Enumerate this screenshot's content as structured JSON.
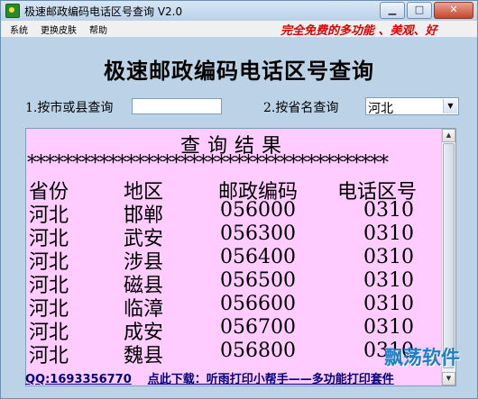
{
  "window": {
    "title": "极速邮政编码电话区号查询 V2.0"
  },
  "menu": [
    "系统",
    "更换皮肤",
    "帮助"
  ],
  "marquee": "完全免费的多功能 、美观、好",
  "app_title": "极速邮政编码电话区号查询",
  "city_query": {
    "label": "1.按市或县查询",
    "value": ""
  },
  "province_query": {
    "label": "2.按省名查询",
    "selected": "河北"
  },
  "results": {
    "title": "查询结果",
    "separator": "****************************************",
    "headers": [
      "省份",
      "地区",
      "邮政编码",
      "电话区号"
    ],
    "rows": [
      [
        "河北",
        "邯郸",
        "056000",
        "0310"
      ],
      [
        "河北",
        "武安",
        "056300",
        "0310"
      ],
      [
        "河北",
        "涉县",
        "056400",
        "0310"
      ],
      [
        "河北",
        "磁县",
        "056500",
        "0310"
      ],
      [
        "河北",
        "临漳",
        "056600",
        "0310"
      ],
      [
        "河北",
        "成安",
        "056700",
        "0310"
      ],
      [
        "河北",
        "魏县",
        "056800",
        "0310"
      ]
    ]
  },
  "footer": {
    "qq": "QQ:1693356770",
    "download": "点此下载：听雨打印小帮手——多功能打印套件"
  },
  "watermark": "飘荡软件",
  "colors": {
    "result_bg": "#ffccff",
    "window_bg": "#bcd3e7",
    "marquee": "#e00000",
    "link": "#000080"
  },
  "icons": [
    "app-icon",
    "minimize-icon",
    "maximize-icon",
    "close-icon",
    "dropdown-arrow-icon",
    "scroll-up-icon",
    "scroll-down-icon"
  ]
}
